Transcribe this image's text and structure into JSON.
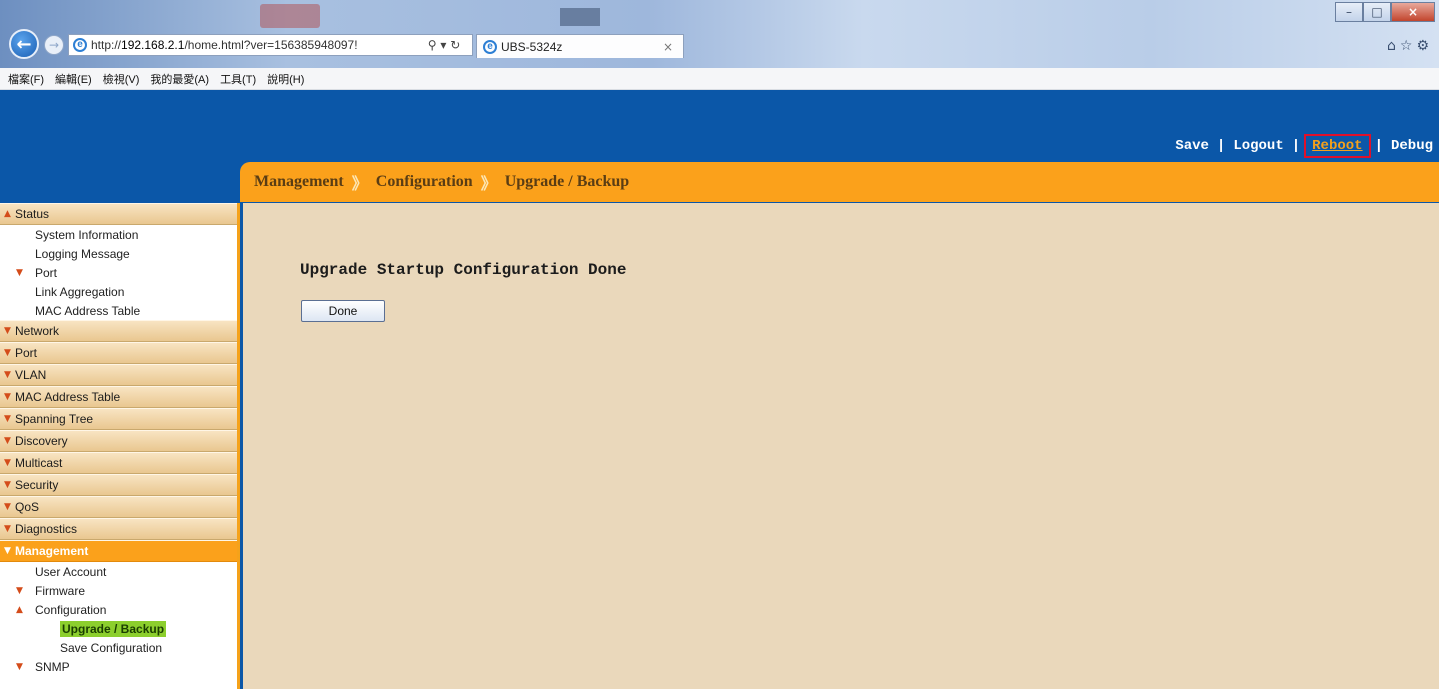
{
  "browser": {
    "url_prefix": "http://",
    "url_host": "192.168.2.1",
    "url_path": "/home.html?ver=156385948097!",
    "addr_tools": "⚲ ▾ ↻",
    "tab_title": "UBS-5324z",
    "tab_close": "×",
    "right_icons": "⌂☆⚙"
  },
  "menubar": [
    "檔案(F)",
    "編輯(E)",
    "檢視(V)",
    "我的最愛(A)",
    "工具(T)",
    "說明(H)"
  ],
  "toplinks": {
    "save": "Save",
    "logout": "Logout",
    "reboot": "Reboot",
    "debug": "Debug",
    "separator": "|"
  },
  "breadcrumb": {
    "items": [
      "Management",
      "Configuration",
      "Upgrade / Backup"
    ],
    "chevron": "》"
  },
  "sidebar": {
    "status": "Status",
    "status_items": {
      "system_information": "System Information",
      "logging_message": "Logging Message",
      "port": "Port",
      "link_aggregation": "Link Aggregation",
      "mac_address_table": "MAC Address Table"
    },
    "sections": [
      "Network",
      "Port",
      "VLAN",
      "MAC Address Table",
      "Spanning Tree",
      "Discovery",
      "Multicast",
      "Security",
      "QoS",
      "Diagnostics"
    ],
    "management": "Management",
    "management_items": {
      "user_account": "User Account",
      "firmware": "Firmware",
      "configuration": "Configuration",
      "upgrade_backup": "Upgrade / Backup",
      "save_configuration": "Save Configuration",
      "snmp": "SNMP"
    },
    "chevron_up": "▲",
    "chevron_down": "▼"
  },
  "content": {
    "title": "Upgrade Startup Configuration Done",
    "done_button": "Done"
  },
  "colors": {
    "page_blue": "#0b57a8",
    "accent_orange": "#fba11b",
    "content_bg": "#ead8bb",
    "highlight_green": "#8ccf2d",
    "reboot_box": "#e0102a"
  }
}
